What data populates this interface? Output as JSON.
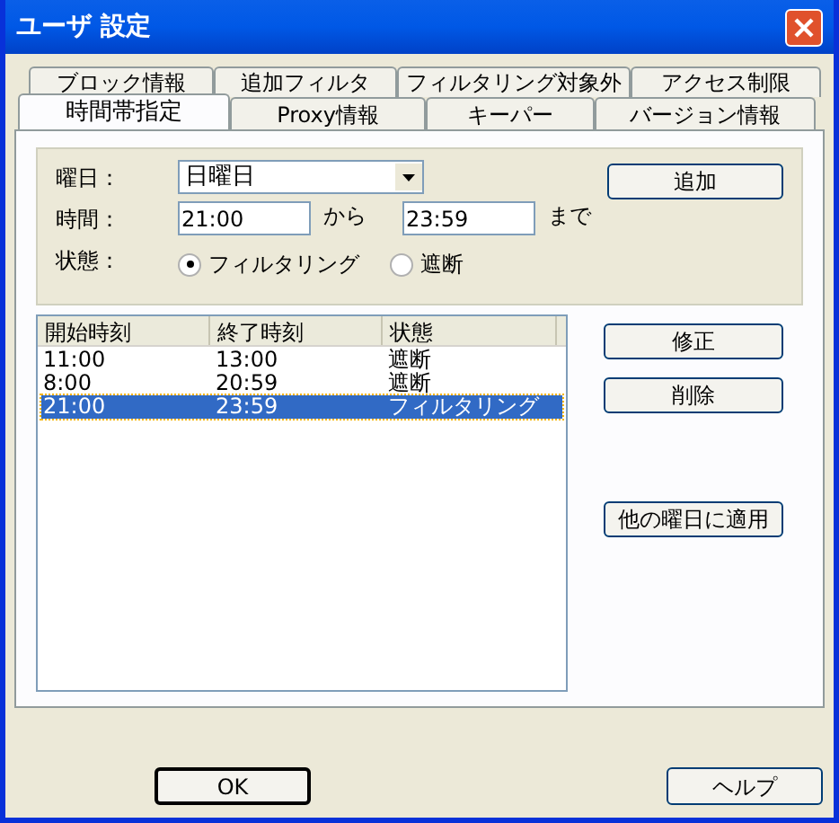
{
  "window": {
    "title": "ユーザ 設定"
  },
  "tab_rows": [
    [
      {
        "label": "ブロック情報",
        "selected": false
      },
      {
        "label": "追加フィルタ",
        "selected": false
      },
      {
        "label": "フィルタリング対象外",
        "selected": false
      },
      {
        "label": "アクセス制限",
        "selected": false
      }
    ],
    [
      {
        "label": "時間帯指定",
        "selected": true
      },
      {
        "label": "Proxy情報",
        "selected": false
      },
      {
        "label": "キーパー",
        "selected": false
      },
      {
        "label": "バージョン情報",
        "selected": false
      }
    ]
  ],
  "form": {
    "day_label": "曜日：",
    "day_value": "日曜日",
    "time_label": "時間：",
    "time_from": "21:00",
    "from_text": "から",
    "time_to": "23:59",
    "to_text": "まで",
    "state_label": "状態：",
    "states": [
      {
        "label": "フィルタリング",
        "selected": true
      },
      {
        "label": "遮断",
        "selected": false
      }
    ],
    "add_button": "追加"
  },
  "table": {
    "columns": [
      "開始時刻",
      "終了時刻",
      "状態"
    ],
    "rows": [
      {
        "cells": [
          "11:00",
          "13:00",
          "遮断"
        ],
        "selected": false
      },
      {
        "cells": [
          "8:00",
          "20:59",
          "遮断"
        ],
        "selected": false
      },
      {
        "cells": [
          "21:00",
          "23:59",
          "フィルタリング"
        ],
        "selected": true
      }
    ]
  },
  "side_buttons": [
    "修正",
    "削除",
    "他の曜日に適用"
  ],
  "buttons": {
    "ok": "OK",
    "help": "ヘルプ"
  }
}
